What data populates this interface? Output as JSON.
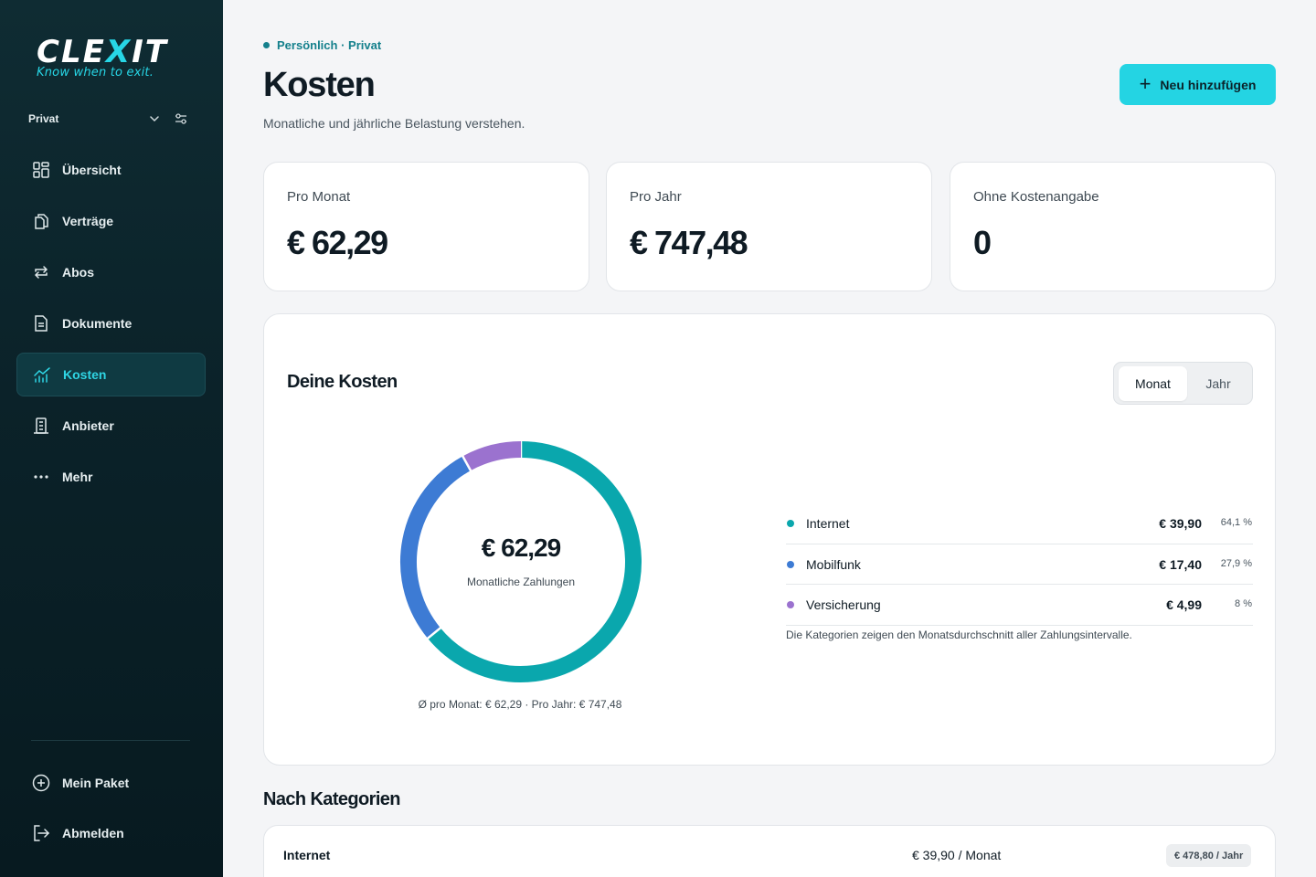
{
  "brand": {
    "name_pre": "CLE",
    "name_x": "X",
    "name_post": "IT",
    "tagline": "Know when to exit.",
    "accent": "#27d6e6"
  },
  "workspace": {
    "label": "Privat"
  },
  "nav": [
    {
      "label": "Übersicht",
      "icon": "grid-icon"
    },
    {
      "label": "Verträge",
      "icon": "documents-icon"
    },
    {
      "label": "Abos",
      "icon": "repeat-icon"
    },
    {
      "label": "Dokumente",
      "icon": "file-icon"
    },
    {
      "label": "Kosten",
      "icon": "chart-icon",
      "active": true
    },
    {
      "label": "Anbieter",
      "icon": "building-icon"
    },
    {
      "label": "Mehr",
      "icon": "more-icon"
    }
  ],
  "bottom_nav": [
    {
      "label": "Mein Paket",
      "icon": "plus-circle-icon"
    },
    {
      "label": "Abmelden",
      "icon": "logout-icon"
    }
  ],
  "header": {
    "breadcrumb": "Persönlich · Privat",
    "title": "Kosten",
    "subtitle": "Monatliche und jährliche Belastung verstehen.",
    "add_button": "Neu hinzufügen"
  },
  "stats": [
    {
      "label": "Pro Monat",
      "value": "€ 62,29"
    },
    {
      "label": "Pro Jahr",
      "value": "€ 747,48"
    },
    {
      "label": "Ohne Kostenangabe",
      "value": "0"
    }
  ],
  "costs_panel": {
    "title": "Deine Kosten",
    "toggle": {
      "active": "Monat",
      "inactive": "Jahr"
    },
    "center_value": "€ 62,29",
    "center_label": "Monatliche Zahlungen",
    "footer": "Ø pro Monat: € 62,29 · Pro Jahr: € 747,48",
    "note": "Die Kategorien zeigen den Monatsdurchschnitt aller Zahlungsintervalle."
  },
  "legend": [
    {
      "name": "Internet",
      "amount": "€ 39,90",
      "pct": "64,1 %",
      "color": "#0aa7ad"
    },
    {
      "name": "Mobilfunk",
      "amount": "€ 17,40",
      "pct": "27,9 %",
      "color": "#3d7bd4"
    },
    {
      "name": "Versicherung",
      "amount": "€ 4,99",
      "pct": "8 %",
      "color": "#9b72cf"
    }
  ],
  "chart_data": {
    "type": "pie",
    "categories": [
      "Internet",
      "Mobilfunk",
      "Versicherung"
    ],
    "values": [
      39.9,
      17.4,
      4.99
    ],
    "colors": [
      "#0aa7ad",
      "#3d7bd4",
      "#9b72cf"
    ],
    "title": "Deine Kosten"
  },
  "categories_section": {
    "title": "Nach Kategorien",
    "rows": [
      {
        "name": "Internet",
        "month": "€ 39,90 / Monat",
        "year": "€ 478,80 / Jahr"
      }
    ]
  }
}
